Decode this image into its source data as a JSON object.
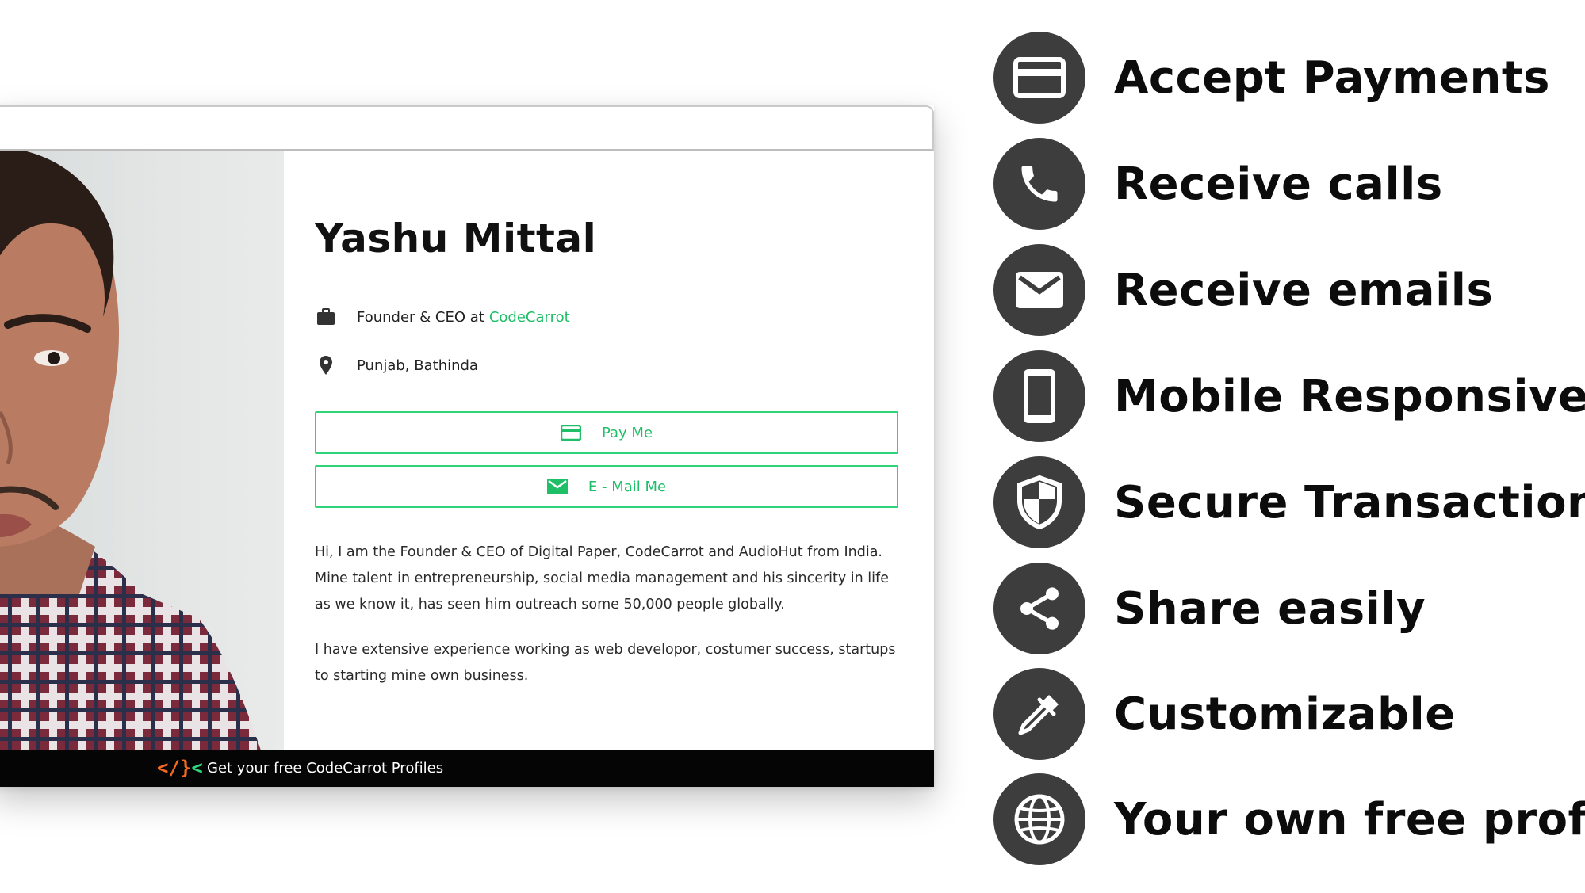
{
  "colors": {
    "accent": "#2ed47a",
    "link": "#1fbf68",
    "icon_circle": "#3d3d3d",
    "footer_bg": "#050505",
    "logo_orange": "#f26a21"
  },
  "profile": {
    "name": "Yashu Mittal",
    "role_text": "Founder & CEO at",
    "company": "CodeCarrot",
    "location": "Punjab, Bathinda",
    "pay_button": "Pay Me",
    "email_button": "E - Mail Me",
    "bio_1": "Hi, I am the Founder & CEO of Digital Paper, CodeCarrot and AudioHut from India. Mine talent in entrepreneurship, social media management and his sincerity in life as we know it, has seen him outreach some 50,000 people globally.",
    "bio_2": "I have extensive experience working as web developor, costumer success, startups to starting mine own business."
  },
  "footer": {
    "logo_left": "</",
    "logo_mid": "}",
    "logo_right": "<",
    "text": "Get your free CodeCarrot Profiles"
  },
  "features": [
    {
      "icon": "credit-card-icon",
      "label": "Accept Payments"
    },
    {
      "icon": "phone-icon",
      "label": "Receive calls"
    },
    {
      "icon": "mail-icon",
      "label": "Receive emails"
    },
    {
      "icon": "smartphone-icon",
      "label": "Mobile Responsive"
    },
    {
      "icon": "shield-icon",
      "label": "Secure Transaction"
    },
    {
      "icon": "share-icon",
      "label": "Share easily"
    },
    {
      "icon": "eyedropper-icon",
      "label": "Customizable"
    },
    {
      "icon": "globe-icon",
      "label": "Your own free profile"
    }
  ]
}
